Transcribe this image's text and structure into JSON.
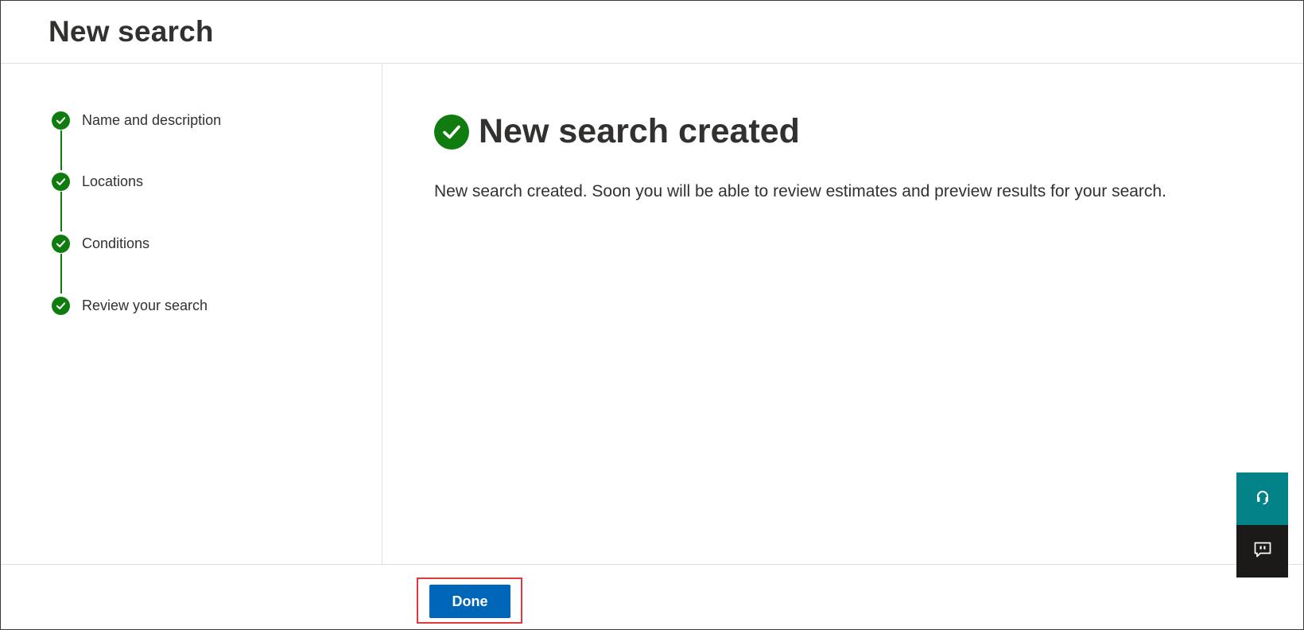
{
  "header": {
    "title": "New search"
  },
  "steps": [
    {
      "label": "Name and description",
      "status_icon": "check-circle-icon"
    },
    {
      "label": "Locations",
      "status_icon": "check-circle-icon"
    },
    {
      "label": "Conditions",
      "status_icon": "check-circle-icon"
    },
    {
      "label": "Review your search",
      "status_icon": "check-circle-icon"
    }
  ],
  "main": {
    "title": "New search created",
    "message": "New search created. Soon you will be able to review estimates and preview results for your search."
  },
  "footer": {
    "done_label": "Done"
  },
  "widgets": {
    "support_icon": "headset-icon",
    "feedback_icon": "feedback-icon"
  },
  "colors": {
    "success": "#107c10",
    "primary": "#0067b8",
    "highlight": "#e0383d",
    "support_bg": "#038387",
    "feedback_bg": "#1b1a19"
  }
}
